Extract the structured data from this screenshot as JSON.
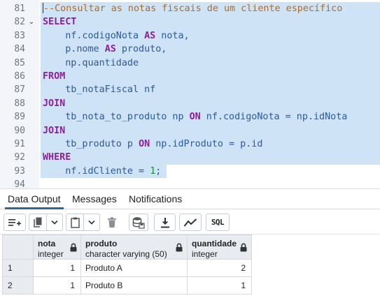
{
  "editor": {
    "lines": [
      {
        "n": "81",
        "fold": ""
      },
      {
        "n": "82",
        "fold": "⌄"
      },
      {
        "n": "83",
        "fold": ""
      },
      {
        "n": "84",
        "fold": ""
      },
      {
        "n": "85",
        "fold": ""
      },
      {
        "n": "86",
        "fold": ""
      },
      {
        "n": "87",
        "fold": ""
      },
      {
        "n": "88",
        "fold": ""
      },
      {
        "n": "89",
        "fold": ""
      },
      {
        "n": "90",
        "fold": ""
      },
      {
        "n": "91",
        "fold": ""
      },
      {
        "n": "92",
        "fold": ""
      },
      {
        "n": "93",
        "fold": ""
      },
      {
        "n": "94",
        "fold": ""
      }
    ],
    "tokens": {
      "l81_comment": "--Consultar as notas fiscais de um cliente específico",
      "l82_kw": "SELECT",
      "l83_a": "    nf.codigoNota ",
      "l83_kw": "AS",
      "l83_b": " nota,",
      "l84_a": "    p.nome ",
      "l84_kw": "AS",
      "l84_b": " produto,",
      "l85_a": "    np.quantidade",
      "l86_kw": "FROM",
      "l87_a": "    tb_notaFiscal nf",
      "l88_kw": "JOIN",
      "l89_a": "    tb_nota_to_produto np ",
      "l89_kw": "ON",
      "l89_b": " nf.codigoNota = np.idNota",
      "l90_kw": "JOIN",
      "l91_a": "    tb_produto p ",
      "l91_kw": "ON",
      "l91_b": " np.idProduto = p.id",
      "l92_kw": "WHERE",
      "l93_a": "    nf.idCliente = ",
      "l93_num": "1",
      "l93_b": ";"
    }
  },
  "tabs": [
    {
      "label": "Data Output",
      "active": true
    },
    {
      "label": "Messages",
      "active": false
    },
    {
      "label": "Notifications",
      "active": false
    }
  ],
  "toolbar": {
    "buttons": [
      "add-row",
      "copy",
      "copy-dropdown",
      "paste",
      "paste-dropdown",
      "delete",
      "save-data",
      "download",
      "graph",
      "sql"
    ],
    "sql_label": "SQL"
  },
  "grid": {
    "columns": [
      {
        "name": "nota",
        "type": "integer"
      },
      {
        "name": "produto",
        "type": "character varying (50)"
      },
      {
        "name": "quantidade",
        "type": "integer"
      }
    ],
    "rows": [
      {
        "num": "1",
        "nota": "1",
        "produto": "Produto A",
        "quantidade": "2"
      },
      {
        "num": "2",
        "nota": "1",
        "produto": "Produto B",
        "quantidade": "1"
      }
    ]
  },
  "colors": {
    "selection": "#cfe3f7",
    "keyword": "#8b1e9a",
    "comment": "#b06b23",
    "identifier": "#2a59a0",
    "number": "#1a8a3a",
    "tab_accent": "#326690",
    "grid_header": "#e8ecf0"
  }
}
